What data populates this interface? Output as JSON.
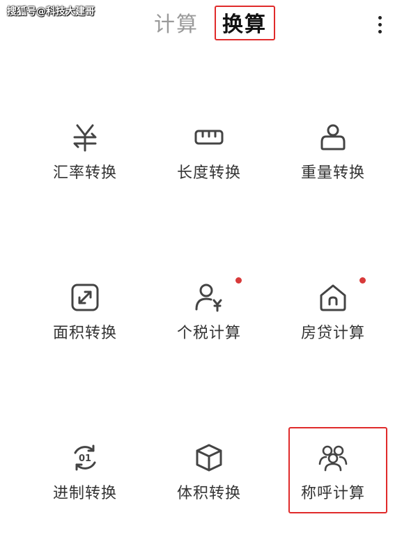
{
  "watermark": "搜狐号@科技大建哥",
  "tabs": [
    {
      "label": "计算",
      "active": false
    },
    {
      "label": "换算",
      "active": true
    }
  ],
  "colors": {
    "highlight": "#e02a2a",
    "badge": "#d83a3a",
    "active_tab": "#111111",
    "inactive_tab": "#9a9a9a",
    "label": "#333333",
    "icon": "#444444"
  },
  "grid": [
    {
      "label": "汇率转换",
      "icon": "yuan-exchange-icon",
      "badge": false
    },
    {
      "label": "长度转换",
      "icon": "ruler-icon",
      "badge": false
    },
    {
      "label": "重量转换",
      "icon": "weight-icon",
      "badge": false
    },
    {
      "label": "面积转换",
      "icon": "area-expand-icon",
      "badge": false
    },
    {
      "label": "个税计算",
      "icon": "person-yuan-icon",
      "badge": true
    },
    {
      "label": "房贷计算",
      "icon": "house-icon",
      "badge": true
    },
    {
      "label": "进制转换",
      "icon": "binary-cycle-icon",
      "badge": false
    },
    {
      "label": "体积转换",
      "icon": "cube-icon",
      "badge": false
    },
    {
      "label": "称呼计算",
      "icon": "people-group-icon",
      "badge": false
    }
  ]
}
